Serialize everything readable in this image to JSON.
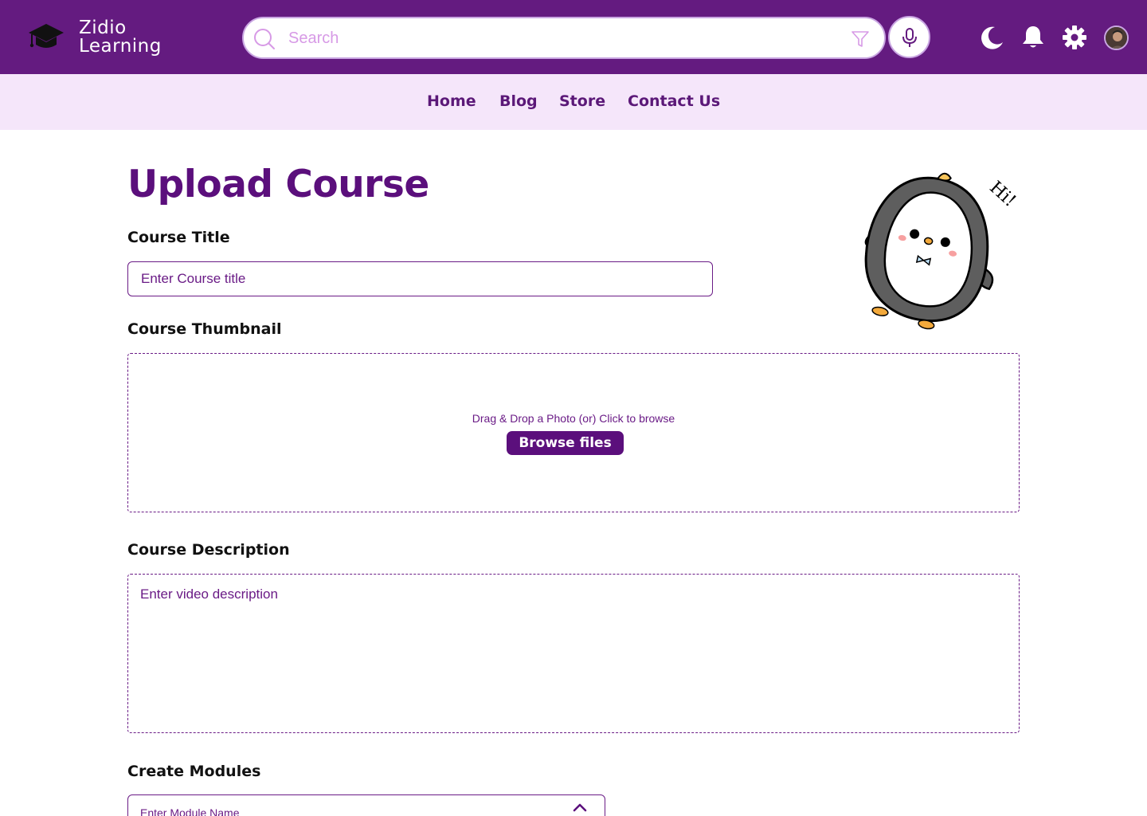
{
  "app": {
    "logo_line1": "Zidio",
    "logo_line2": "Learning"
  },
  "search": {
    "placeholder": "Search",
    "value": ""
  },
  "nav": {
    "items": [
      {
        "label": "Home"
      },
      {
        "label": "Blog"
      },
      {
        "label": "Store"
      },
      {
        "label": "Contact Us"
      }
    ]
  },
  "page": {
    "title": "Upload Course"
  },
  "form": {
    "course_title_label": "Course Title",
    "course_title_placeholder": "Enter Course title",
    "thumbnail_label": "Course Thumbnail",
    "thumbnail_hint": "Drag & Drop a Photo (or) Click to browse",
    "browse_label": "Browse files",
    "description_label": "Course Description",
    "description_placeholder": "Enter video description",
    "modules_label": "Create Modules",
    "module_name_placeholder": "Enter Module Name"
  },
  "mascot": {
    "greeting": "Hi!"
  },
  "icons": {
    "logo": "graduation-cap-icon",
    "search": "search-icon",
    "filter": "filter-icon",
    "mic": "microphone-icon",
    "theme": "moon-icon",
    "notifications": "bell-icon",
    "settings": "gear-icon",
    "module_toggle": "chevron-up-icon"
  },
  "colors": {
    "brand": "#641b80",
    "nav_bg": "#f5e6fa",
    "accent": "#5b0f7c",
    "placeholder": "#d79ae6"
  }
}
